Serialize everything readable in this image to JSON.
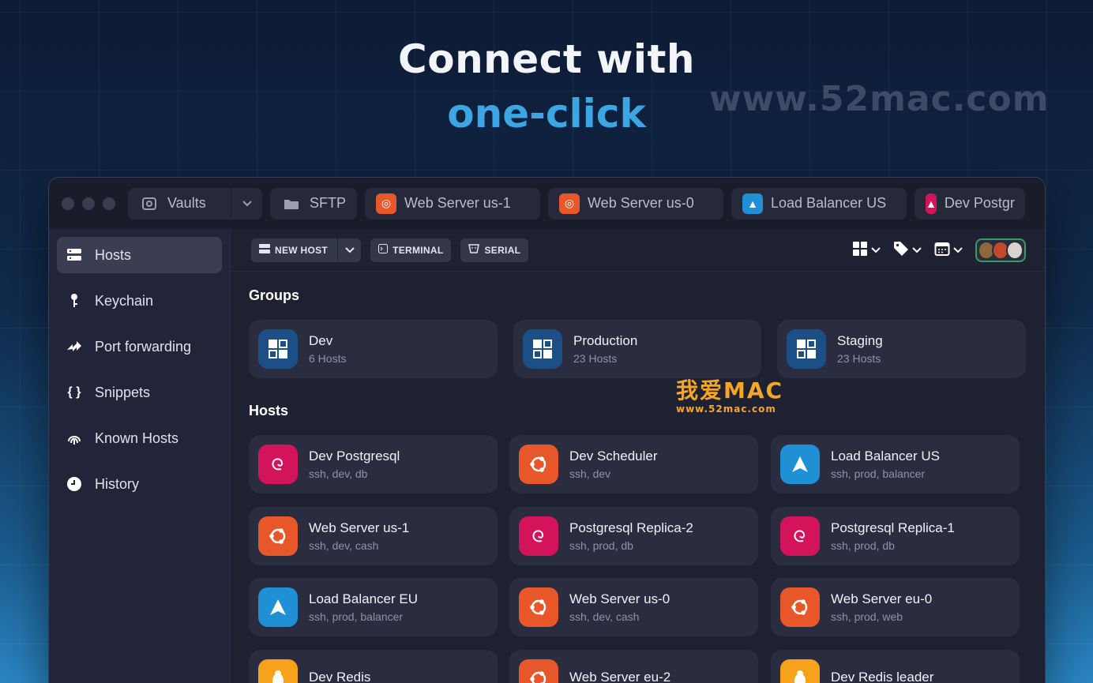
{
  "hero": {
    "line1": "Connect with",
    "line2": "one-click",
    "watermark": "www.52mac.com"
  },
  "overlay_logo": {
    "brand": "我爱MAC",
    "url": "www.52mac.com"
  },
  "titlebar": {
    "tabs": [
      {
        "label": "Vaults",
        "icon": "vault-icon"
      },
      {
        "label": "SFTP",
        "icon": "folder-icon"
      },
      {
        "label": "Web Server us-1",
        "icon": "ubuntu-icon",
        "color": "#e8572a"
      },
      {
        "label": "Web Server us-0",
        "icon": "ubuntu-icon",
        "color": "#e8572a"
      },
      {
        "label": "Load Balancer US",
        "icon": "arch-icon",
        "color": "#1f8fd6"
      },
      {
        "label": "Dev Postgr",
        "icon": "debian-icon",
        "color": "#d4145a"
      }
    ]
  },
  "sidebar": {
    "items": [
      {
        "label": "Hosts",
        "icon": "hosts-icon",
        "active": true
      },
      {
        "label": "Keychain",
        "icon": "key-icon"
      },
      {
        "label": "Port forwarding",
        "icon": "port-forward-icon"
      },
      {
        "label": "Snippets",
        "icon": "snippets-icon"
      },
      {
        "label": "Known Hosts",
        "icon": "fingerprint-icon"
      },
      {
        "label": "History",
        "icon": "clock-icon"
      }
    ]
  },
  "toolbar": {
    "new_host": "NEW HOST",
    "terminal": "TERMINAL",
    "serial": "SERIAL",
    "right_tools": [
      "grid-view-icon",
      "tag-icon",
      "calendar-icon"
    ]
  },
  "groups": {
    "title": "Groups",
    "items": [
      {
        "name": "Dev",
        "count": "6 Hosts"
      },
      {
        "name": "Production",
        "count": "23 Hosts"
      },
      {
        "name": "Staging",
        "count": "23 Hosts"
      }
    ]
  },
  "hosts": {
    "title": "Hosts",
    "items": [
      {
        "name": "Dev Postgresql",
        "tags": "ssh, dev, db",
        "os": "debian"
      },
      {
        "name": "Dev Scheduler",
        "tags": "ssh, dev",
        "os": "ubuntu"
      },
      {
        "name": "Load Balancer US",
        "tags": "ssh, prod, balancer",
        "os": "arch"
      },
      {
        "name": "Web Server us-1",
        "tags": "ssh, dev, cash",
        "os": "ubuntu"
      },
      {
        "name": "Postgresql Replica-2",
        "tags": "ssh, prod, db",
        "os": "debian"
      },
      {
        "name": "Postgresql Replica-1",
        "tags": "ssh, prod, db",
        "os": "debian"
      },
      {
        "name": "Load Balancer EU",
        "tags": "ssh, prod, balancer",
        "os": "arch"
      },
      {
        "name": "Web Server us-0",
        "tags": "ssh, dev, cash",
        "os": "ubuntu"
      },
      {
        "name": "Web Server eu-0",
        "tags": "ssh, prod, web",
        "os": "ubuntu"
      },
      {
        "name": "Dev Redis",
        "tags": "",
        "os": "linux"
      },
      {
        "name": "Web Server eu-2",
        "tags": "",
        "os": "ubuntu"
      },
      {
        "name": "Dev Redis leader",
        "tags": "",
        "os": "linux"
      }
    ]
  }
}
